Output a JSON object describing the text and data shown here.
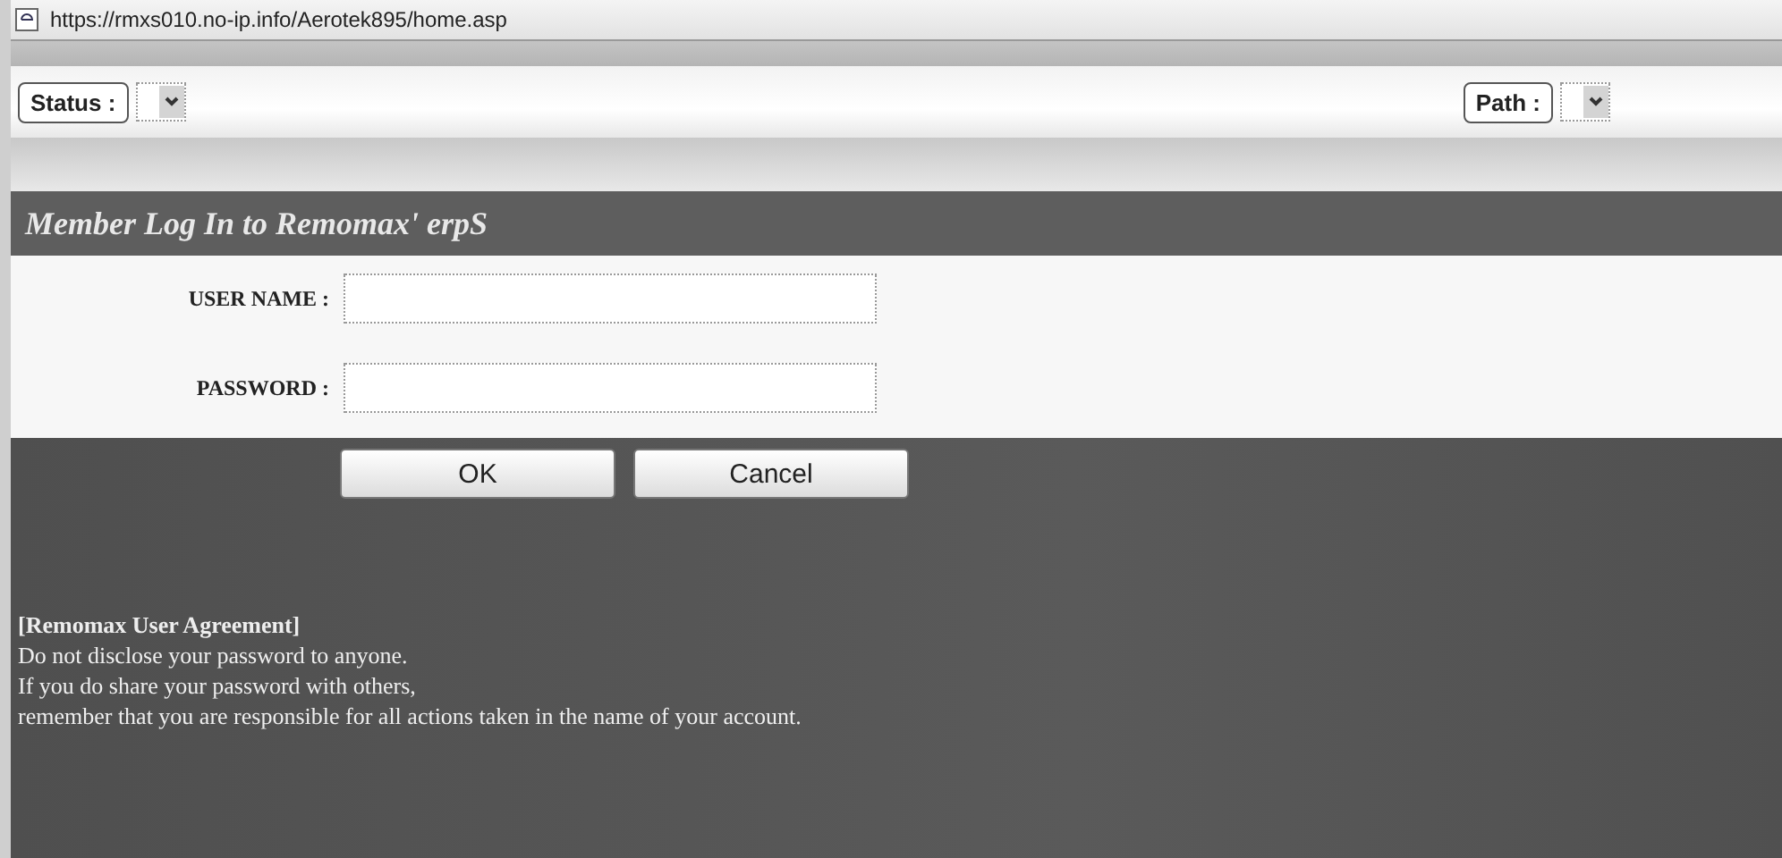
{
  "address_bar": {
    "url": "https://rmxs010.no-ip.info/Aerotek895/home.asp"
  },
  "toolbar": {
    "left": {
      "label": "Status :"
    },
    "right": {
      "label": "Path :"
    }
  },
  "login": {
    "title": "Member Log In to Remomax' erpS",
    "fields": [
      {
        "label": "USER NAME :"
      },
      {
        "label": "PASSWORD :"
      }
    ],
    "buttons": [
      "OK",
      "Cancel"
    ]
  },
  "agreement": {
    "heading": "[Remomax User Agreement]",
    "lines": [
      "Do not disclose your password to anyone.",
      "If you do share your password with others,",
      "remember that you are responsible for all actions taken in the name of your account."
    ]
  }
}
